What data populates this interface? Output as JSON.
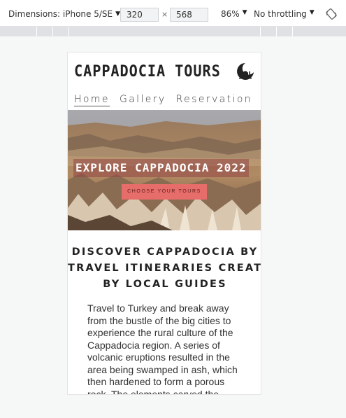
{
  "devtools": {
    "device_label": "Dimensions: iPhone 5/SE",
    "width": "320",
    "times": "×",
    "height": "568",
    "zoom": "86%",
    "throttle": "No throttling",
    "icons": [
      "chevron-down-icon",
      "rotate-icon"
    ]
  },
  "site": {
    "title": "CAPPADOCIA TOURS",
    "logo_icon": "mosque-moon-icon",
    "nav": [
      {
        "label": "Home",
        "active": true
      },
      {
        "label": "Gallery",
        "active": false
      },
      {
        "label": "Reservation",
        "active": false
      }
    ],
    "hero": {
      "title": "EXPLORE CAPPADOCIA 2022",
      "cta": "CHOOSE YOUR TOURS"
    },
    "heading_lines": [
      "DISCOVER CAPPADOCIA BY",
      "TRAVEL ITINERARIES CREATED",
      "BY LOCAL GUIDES"
    ],
    "body_lines": [
      "Travel to Turkey and break away",
      "from the bustle of the big cities to",
      "experience the rural culture of the",
      "Cappadocia region. A series of",
      "volcanic eruptions resulted in the",
      "area being swamped in ash, which",
      "then hardened to form a porous",
      "rock. The elements carved the"
    ]
  },
  "colors": {
    "accent": "#e76d6a",
    "hero_title_bg": "#964646",
    "text": "#222222"
  }
}
